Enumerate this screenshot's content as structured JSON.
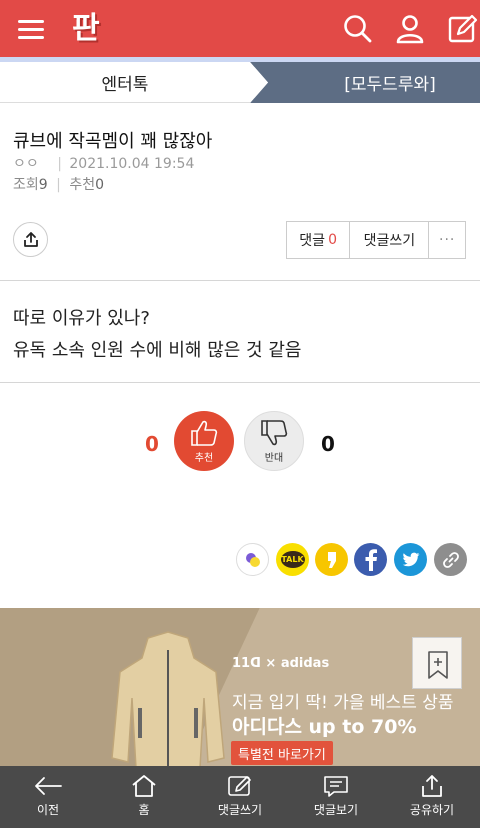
{
  "header": {
    "logo_text": "판",
    "icons": [
      "menu-icon",
      "search-icon",
      "user-icon",
      "write-icon"
    ],
    "colors": {
      "brand": "#e24a47"
    }
  },
  "category": {
    "left_tab": "엔터톡",
    "right_tab": "[모두드루와]"
  },
  "post": {
    "title": "큐브에 작곡멤이 꽤 많잖아",
    "author": "ㅇㅇ",
    "date": "2021.10.04 19:54",
    "views_label": "조회",
    "views": "9",
    "recommend_label": "추천",
    "recommend": "0",
    "body_lines": [
      "따로 이유가 있나?",
      "유독 소속 인원 수에 비해 많은 것 같음"
    ]
  },
  "actions": {
    "comment_label": "댓글",
    "comment_count": "0",
    "write_comment": "댓글쓰기",
    "more": "···"
  },
  "vote": {
    "up_count": "0",
    "up_label": "추천",
    "down_label": "반대",
    "down_count": "0"
  },
  "share_icons": [
    "kakaostory-icon",
    "kakaotalk-icon",
    "kakao-channel-icon",
    "facebook-icon",
    "twitter-icon",
    "link-icon"
  ],
  "share_talk_text": "TALK",
  "ad": {
    "brand": "11ᗡ × adidas",
    "line1": "지금 입기 딱! 가을 베스트 상품",
    "line2": "아디다스 up to 70%",
    "cta": "특별전 바로가기"
  },
  "bottom_nav": [
    {
      "label": "이전",
      "icon": "back-arrow-icon"
    },
    {
      "label": "홈",
      "icon": "home-icon"
    },
    {
      "label": "댓글쓰기",
      "icon": "comment-write-icon"
    },
    {
      "label": "댓글보기",
      "icon": "comment-view-icon"
    },
    {
      "label": "공유하기",
      "icon": "share-icon"
    }
  ]
}
